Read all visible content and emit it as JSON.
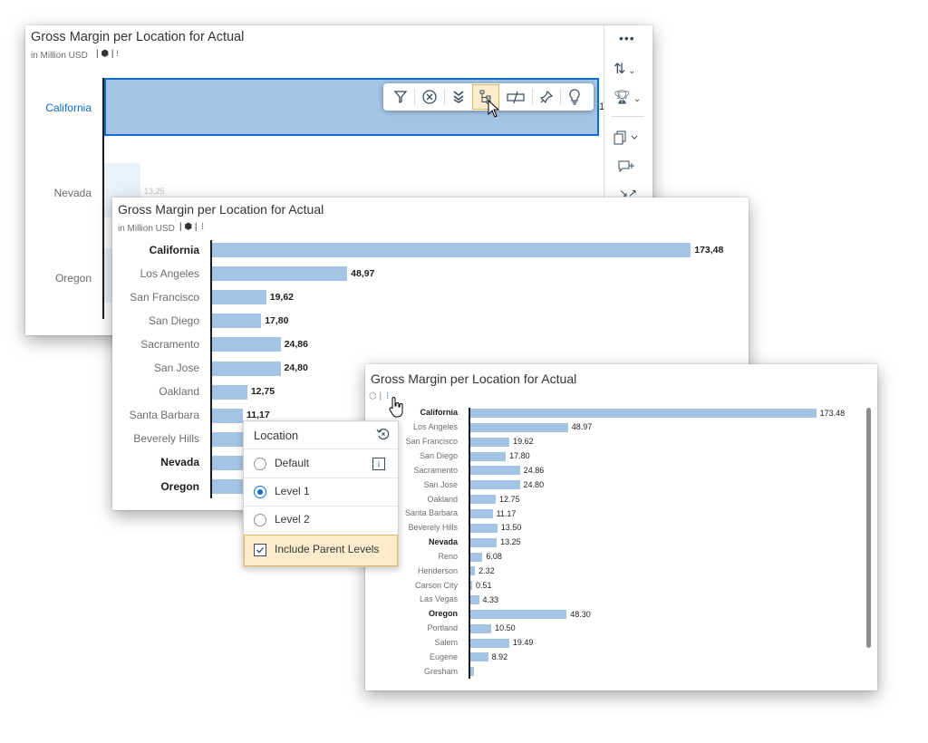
{
  "panel1": {
    "title": "Gross Margin per Location for Actual",
    "subtitle": "in Million USD",
    "rows": [
      "California",
      "Nevada",
      "Oregon"
    ],
    "nevada_value": "13,25",
    "ca_value_fragment": "1"
  },
  "toolbar_icons": [
    "filter-icon",
    "exclude-icon",
    "drill-down-icon",
    "hierarchy-icon",
    "compare-icon",
    "pin-icon",
    "lightbulb-icon"
  ],
  "side_icons": [
    "more-icon",
    "sort-icon",
    "ranking-icon",
    "copy-icon",
    "add-comment-icon",
    "expand-icon"
  ],
  "panel2": {
    "title": "Gross Margin per Location for Actual",
    "subtitle": "in Million USD"
  },
  "panel3": {
    "title": "Gross Margin per Location for Actual"
  },
  "menu": {
    "header": "Location",
    "options": [
      "Default",
      "Level 1",
      "Level 2"
    ],
    "selected": "Level 1",
    "checkbox_label": "Include Parent Levels",
    "checkbox_checked": true
  },
  "colors": {
    "bar": "#a4c4e6",
    "accent": "#0a6ed1",
    "highlight": "#fdeccb"
  },
  "chart_data": [
    {
      "type": "bar",
      "orientation": "horizontal",
      "categories": [
        "California",
        "Los Angeles",
        "San Francisco",
        "San Diego",
        "Sacramento",
        "San Jose",
        "Oakland",
        "Santa Barbara",
        "Beverely Hills",
        "Nevada",
        "Oregon"
      ],
      "values": [
        173.48,
        48.97,
        19.62,
        17.8,
        24.86,
        24.8,
        12.75,
        11.17,
        null,
        null,
        null
      ],
      "labels": [
        "173,48",
        "48,97",
        "19,62",
        "17,80",
        "24,86",
        "24,80",
        "12,75",
        "11,17",
        "",
        "",
        ""
      ],
      "bold": [
        "California",
        "Nevada",
        "Oregon"
      ]
    },
    {
      "type": "bar",
      "orientation": "horizontal",
      "categories": [
        "California",
        "Los Angeles",
        "San Francisco",
        "San Diego",
        "Sacramento",
        "San Jose",
        "Oakland",
        "Santa Barbara",
        "Beverely Hills",
        "Nevada",
        "Reno",
        "Henderson",
        "Carson City",
        "Las Vegas",
        "Oregon",
        "Portland",
        "Salem",
        "Eugene",
        "Gresham"
      ],
      "values": [
        173.48,
        48.97,
        19.62,
        17.8,
        24.86,
        24.8,
        12.75,
        11.17,
        13.5,
        13.25,
        6.08,
        2.32,
        0.51,
        4.33,
        48.3,
        10.5,
        19.49,
        8.92,
        2.0
      ],
      "labels": [
        "173.48",
        "48.97",
        "19.62",
        "17.80",
        "24.86",
        "24.80",
        "12.75",
        "11.17",
        "13.50",
        "13.25",
        "6.08",
        "2.32",
        "0.51",
        "4.33",
        "48.30",
        "10.50",
        "19.49",
        "8.92",
        ""
      ],
      "bold": [
        "California",
        "Nevada",
        "Oregon"
      ]
    }
  ]
}
